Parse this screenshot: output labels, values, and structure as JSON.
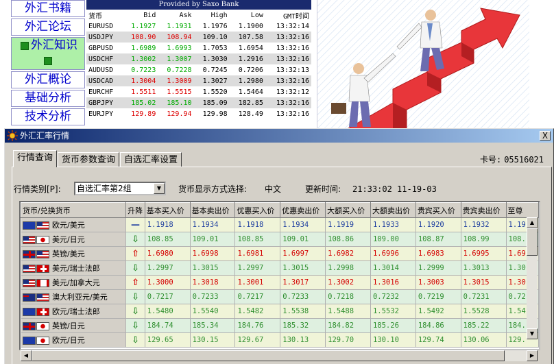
{
  "background_page": {
    "side_menu": [
      "外汇书籍",
      "外汇论坛",
      "外汇知识",
      "外汇概论",
      "基础分析",
      "技术分析"
    ],
    "active_index": 2,
    "quote_box": {
      "header": "Provided by Saxo Bank",
      "columns": [
        "货币",
        "Bid",
        "Ask",
        "High",
        "Low",
        "GMT时间"
      ],
      "rows": [
        {
          "pair": "EURUSD",
          "bid": "1.1927",
          "ask": "1.1931",
          "high": "1.1976",
          "low": "1.1900",
          "time": "13:32:14",
          "dir": "up"
        },
        {
          "pair": "USDJPY",
          "bid": "108.90",
          "ask": "108.94",
          "high": "109.10",
          "low": "107.58",
          "time": "13:32:16",
          "dir": "down"
        },
        {
          "pair": "GBPUSD",
          "bid": "1.6989",
          "ask": "1.6993",
          "high": "1.7053",
          "low": "1.6954",
          "time": "13:32:16",
          "dir": "up"
        },
        {
          "pair": "USDCHF",
          "bid": "1.3002",
          "ask": "1.3007",
          "high": "1.3030",
          "low": "1.2916",
          "time": "13:32:16",
          "dir": "up"
        },
        {
          "pair": "AUDUSD",
          "bid": "0.7223",
          "ask": "0.7228",
          "high": "0.7245",
          "low": "0.7206",
          "time": "13:32:13",
          "dir": "up"
        },
        {
          "pair": "USDCAD",
          "bid": "1.3004",
          "ask": "1.3009",
          "high": "1.3027",
          "low": "1.2980",
          "time": "13:32:16",
          "dir": "down"
        },
        {
          "pair": "EURCHF",
          "bid": "1.5511",
          "ask": "1.5515",
          "high": "1.5520",
          "low": "1.5464",
          "time": "13:32:12",
          "dir": "down"
        },
        {
          "pair": "GBPJPY",
          "bid": "185.02",
          "ask": "185.10",
          "high": "185.09",
          "low": "182.85",
          "time": "13:32:16",
          "dir": "up"
        },
        {
          "pair": "EURJPY",
          "bid": "129.89",
          "ask": "129.94",
          "high": "129.98",
          "low": "128.49",
          "time": "13:32:16",
          "dir": "down"
        }
      ]
    }
  },
  "dialog": {
    "title": "外汇汇率行情",
    "close_label": "X",
    "tabs": [
      "行情查询",
      "货币参数查询",
      "自选汇率设置"
    ],
    "active_tab": 0,
    "card_label": "卡号:",
    "card_number": "05516021",
    "filter": {
      "category_label": "行情类别[P]:",
      "category_value": "自选汇率第2组",
      "display_label": "货币显示方式选择:",
      "display_value": "中文",
      "update_label": "更新时间:",
      "update_value": "21:33:02   11-19-03"
    },
    "table": {
      "columns": [
        "货币/兑换货币",
        "升降",
        "基本买入价",
        "基本卖出价",
        "优惠买入价",
        "优惠卖出价",
        "大额买入价",
        "大额卖出价",
        "贵宾买入价",
        "贵宾卖出价",
        "至尊"
      ],
      "rows": [
        {
          "flags": [
            "EU",
            "US"
          ],
          "name": "欧元/美元",
          "dir": "flat",
          "values": [
            "1.1918",
            "1.1934",
            "1.1918",
            "1.1934",
            "1.1919",
            "1.1933",
            "1.1920",
            "1.1932",
            "1.19"
          ]
        },
        {
          "flags": [
            "US",
            "JP"
          ],
          "name": "美元/日元",
          "dir": "down",
          "values": [
            "108.85",
            "109.01",
            "108.85",
            "109.01",
            "108.86",
            "109.00",
            "108.87",
            "108.99",
            "108."
          ]
        },
        {
          "flags": [
            "GB",
            "US"
          ],
          "name": "英镑/美元",
          "dir": "up",
          "values": [
            "1.6980",
            "1.6998",
            "1.6981",
            "1.6997",
            "1.6982",
            "1.6996",
            "1.6983",
            "1.6995",
            "1.69"
          ]
        },
        {
          "flags": [
            "US",
            "CH"
          ],
          "name": "美元/瑞士法郎",
          "dir": "down",
          "values": [
            "1.2997",
            "1.3015",
            "1.2997",
            "1.3015",
            "1.2998",
            "1.3014",
            "1.2999",
            "1.3013",
            "1.30"
          ]
        },
        {
          "flags": [
            "US",
            "CA"
          ],
          "name": "美元/加拿大元",
          "dir": "up",
          "values": [
            "1.3000",
            "1.3018",
            "1.3001",
            "1.3017",
            "1.3002",
            "1.3016",
            "1.3003",
            "1.3015",
            "1.30"
          ]
        },
        {
          "flags": [
            "AU",
            "US"
          ],
          "name": "澳大利亚元/美元",
          "dir": "down",
          "values": [
            "0.7217",
            "0.7233",
            "0.7217",
            "0.7233",
            "0.7218",
            "0.7232",
            "0.7219",
            "0.7231",
            "0.72"
          ]
        },
        {
          "flags": [
            "EU",
            "CH"
          ],
          "name": "欧元/瑞士法郎",
          "dir": "down",
          "values": [
            "1.5480",
            "1.5540",
            "1.5482",
            "1.5538",
            "1.5488",
            "1.5532",
            "1.5492",
            "1.5528",
            "1.54"
          ]
        },
        {
          "flags": [
            "GB",
            "JP"
          ],
          "name": "英镑/日元",
          "dir": "down",
          "values": [
            "184.74",
            "185.34",
            "184.76",
            "185.32",
            "184.82",
            "185.26",
            "184.86",
            "185.22",
            "184."
          ]
        },
        {
          "flags": [
            "EU",
            "JP"
          ],
          "name": "欧元/日元",
          "dir": "down",
          "values": [
            "129.65",
            "130.15",
            "129.67",
            "130.13",
            "129.70",
            "130.10",
            "129.74",
            "130.06",
            "129."
          ]
        }
      ]
    }
  },
  "colors": {
    "up": "#d40000",
    "down": "#2f8f2f",
    "flat": "#2040a0",
    "title_bar": "#0a246a"
  }
}
